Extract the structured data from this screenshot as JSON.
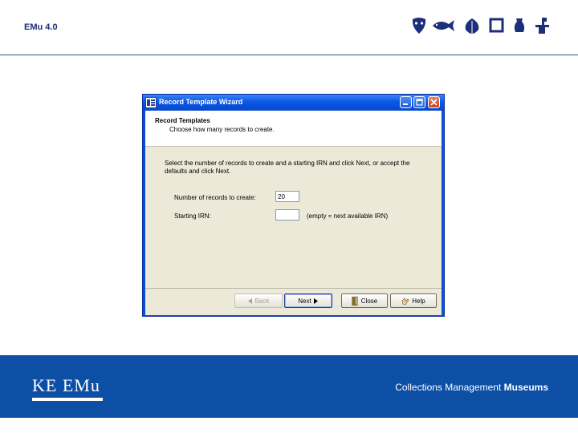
{
  "slide": {
    "title": "EMu 4.0",
    "icons": [
      "mask-icon",
      "fish-icon",
      "leaf-icon",
      "frame-icon",
      "vase-icon",
      "statue-icon"
    ]
  },
  "window": {
    "title": "Record Template Wizard",
    "app_icon": "emu-app-icon",
    "controls": [
      "minimize-icon",
      "maximize-icon",
      "close-icon"
    ],
    "header": {
      "heading": "Record Templates",
      "subheading": "Choose how many records to create."
    },
    "instructions": "Select the number of records to create and a starting IRN and click Next, or accept the defaults and click Next.",
    "fields": {
      "count_label": "Number of records to create:",
      "count_value": "20",
      "irn_label": "Starting IRN:",
      "irn_value": "",
      "irn_hint": "(empty = next available IRN)"
    },
    "buttons": {
      "back": "Back",
      "next": "Next",
      "close": "Close",
      "help": "Help"
    }
  },
  "footer": {
    "logo_text": "KE EMu",
    "tagline_regular": "Collections Management",
    "tagline_bold": "Museums"
  },
  "colors": {
    "header_rule": "#1f4f8a",
    "footer_band": "#0e4fa6",
    "titlebar": "#0a58e8",
    "dialog_face": "#ece9d8"
  }
}
